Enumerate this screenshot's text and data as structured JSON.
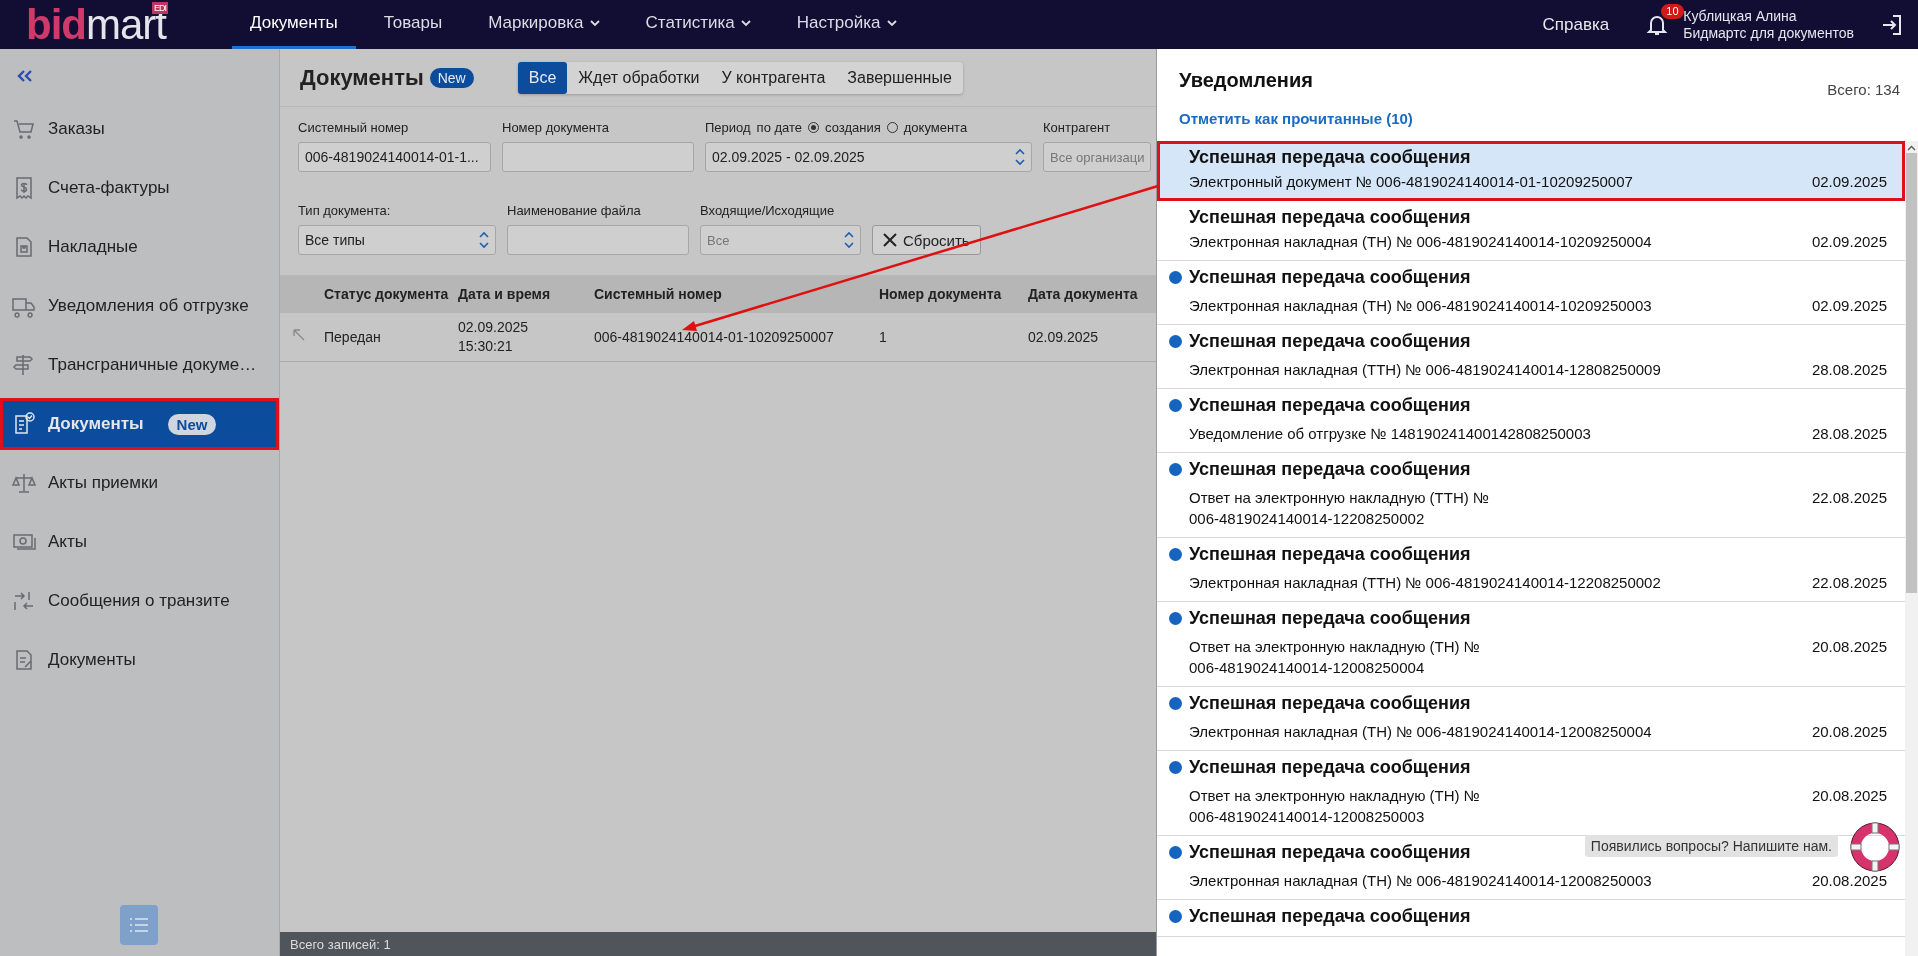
{
  "topbar": {
    "logo": {
      "accent": "bid",
      "rest": "mart",
      "badge": "EDI"
    },
    "nav": [
      {
        "label": "Документы",
        "selected": true,
        "dropdown": false
      },
      {
        "label": "Товары",
        "selected": false,
        "dropdown": false
      },
      {
        "label": "Маркировка",
        "selected": false,
        "dropdown": true
      },
      {
        "label": "Статистика",
        "selected": false,
        "dropdown": true
      },
      {
        "label": "Настройка",
        "selected": false,
        "dropdown": true
      }
    ],
    "help": "Справка",
    "notification_count": "10",
    "user": {
      "name": "Кублицкая Алина",
      "org": "Бидмартс для документов"
    }
  },
  "sidebar": {
    "items": [
      {
        "label": "Заказы",
        "selected": false,
        "annotated": false
      },
      {
        "label": "Счета-фактуры",
        "selected": false,
        "annotated": false
      },
      {
        "label": "Накладные",
        "selected": false,
        "annotated": false
      },
      {
        "label": "Уведомления об отгрузке",
        "selected": false,
        "annotated": false
      },
      {
        "label": "Трансграничные докуме…",
        "selected": false,
        "annotated": false
      },
      {
        "label": "Документы",
        "badge": "New",
        "selected": true,
        "annotated": true
      },
      {
        "label": "Акты приемки",
        "selected": false,
        "annotated": false
      },
      {
        "label": "Акты",
        "selected": false,
        "annotated": false
      },
      {
        "label": "Сообщения о транзите",
        "selected": false,
        "annotated": false
      },
      {
        "label": "Документы",
        "selected": false,
        "annotated": false
      }
    ]
  },
  "documents": {
    "title": "Документы",
    "badge": "New",
    "tabs": [
      {
        "label": "Все",
        "selected": true
      },
      {
        "label": "Ждет обработки",
        "selected": false
      },
      {
        "label": "У контрагента",
        "selected": false
      },
      {
        "label": "Завершенные",
        "selected": false
      }
    ],
    "filter_rows": [
      [
        {
          "kind": "text",
          "label": "Системный номер",
          "value": "006-4819024140014-01-1..."
        },
        {
          "kind": "text",
          "label": "Номер документа"
        },
        {
          "kind": "period",
          "label": "Период",
          "sublabel": "по дате",
          "options": [
            {
              "label": "создания",
              "selected": true
            },
            {
              "label": "документа",
              "selected": false
            }
          ],
          "value": "02.09.2025 - 02.09.2025"
        },
        {
          "kind": "text",
          "label": "Контрагент",
          "placeholder": "Все организаци"
        }
      ],
      [
        {
          "kind": "select",
          "label": "Тип документа:",
          "value": "Все типы"
        },
        {
          "kind": "text",
          "label": "Наименование файла"
        },
        {
          "kind": "select",
          "label": "Входящие/Исходящие",
          "placeholder": "Все"
        },
        {
          "kind": "button",
          "label": "Сбросить"
        }
      ]
    ],
    "table": {
      "columns": [
        "Статус документа",
        "Дата и время",
        "Системный номер",
        "Номер документа",
        "Дата документа"
      ],
      "rows": [
        {
          "cells": [
            "Передан",
            "02.09.2025\n15:30:21",
            "006-4819024140014-01-10209250007",
            "1",
            "02.09.2025"
          ]
        }
      ]
    },
    "footer": "Всего записей: 1"
  },
  "notifications": {
    "title": "Уведомления",
    "total": "Всего: 134",
    "mark_read": "Отметить как прочитанные (10)",
    "items": [
      {
        "title": "Успешная передача сообщения",
        "text": "Электронный документ № 006-4819024140014-01-10209250007",
        "date": "02.09.2025",
        "unread": false,
        "selected": true,
        "annotated": true
      },
      {
        "title": "Успешная передача сообщения",
        "text": "Электронная накладная (ТН) № 006-4819024140014-10209250004",
        "date": "02.09.2025",
        "unread": false,
        "selected": false,
        "annotated": false
      },
      {
        "title": "Успешная передача сообщения",
        "text": "Электронная накладная (ТН) № 006-4819024140014-10209250003",
        "date": "02.09.2025",
        "unread": true,
        "selected": false,
        "annotated": false
      },
      {
        "title": "Успешная передача сообщения",
        "text": "Электронная накладная (ТТН) № 006-4819024140014-12808250009",
        "date": "28.08.2025",
        "unread": true,
        "selected": false,
        "annotated": false
      },
      {
        "title": "Успешная передача сообщения",
        "text": "Уведомление об отгрузке № 148190241400142808250003",
        "date": "28.08.2025",
        "unread": true,
        "selected": false,
        "annotated": false
      },
      {
        "title": "Успешная передача сообщения",
        "text": "Ответ на электронную накладную (ТТН) №\n006-4819024140014-12208250002",
        "date": "22.08.2025",
        "unread": true,
        "selected": false,
        "annotated": false
      },
      {
        "title": "Успешная передача сообщения",
        "text": "Электронная накладная (ТТН) № 006-4819024140014-12208250002",
        "date": "22.08.2025",
        "unread": true,
        "selected": false,
        "annotated": false
      },
      {
        "title": "Успешная передача сообщения",
        "text": "Ответ на электронную накладную (ТН) №\n006-4819024140014-12008250004",
        "date": "20.08.2025",
        "unread": true,
        "selected": false,
        "annotated": false
      },
      {
        "title": "Успешная передача сообщения",
        "text": "Электронная накладная (ТН) № 006-4819024140014-12008250004",
        "date": "20.08.2025",
        "unread": true,
        "selected": false,
        "annotated": false
      },
      {
        "title": "Успешная передача сообщения",
        "text": "Ответ на электронную накладную (ТН) №\n006-4819024140014-12008250003",
        "date": "20.08.2025",
        "unread": true,
        "selected": false,
        "annotated": false
      },
      {
        "title": "Успешная передача сообщения",
        "text": "Электронная накладная (ТН) № 006-4819024140014-12008250003",
        "date": "20.08.2025",
        "unread": true,
        "selected": false,
        "annotated": false
      },
      {
        "title": "Успешная передача сообщения",
        "unread": true,
        "selected": false,
        "annotated": false
      }
    ]
  },
  "help_widget": {
    "text": "Появились вопросы? Напишите нам."
  }
}
